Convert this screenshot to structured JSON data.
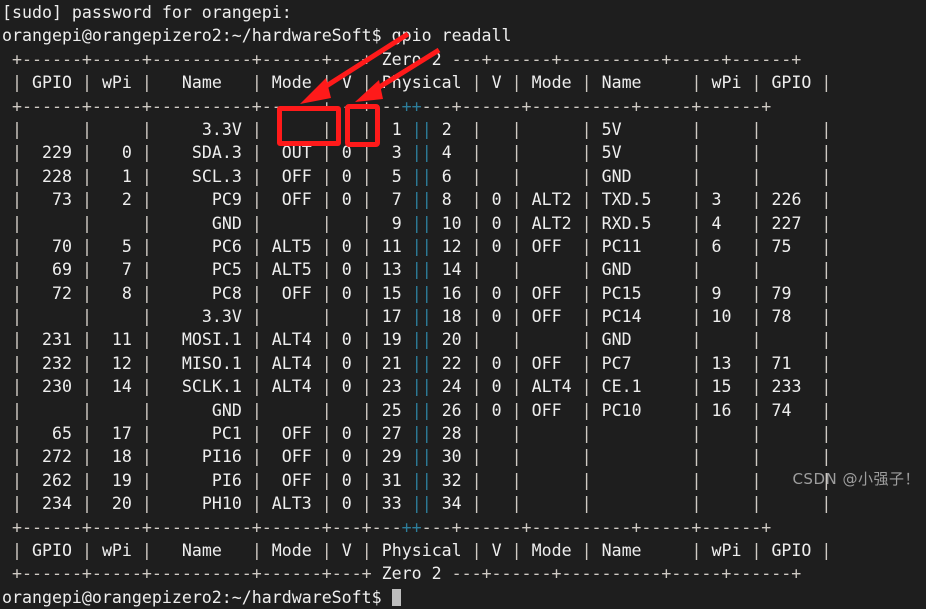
{
  "terminal": {
    "prompt_user_host": "orangepi@orangepizero2:~/hardwareSoft$",
    "sudo_line": "[sudo] password for orangepi:",
    "command": "gpio readall",
    "board_label": "Zero 2",
    "final_prompt": "orangepi@orangepizero2:~/hardwareSoft$"
  },
  "table": {
    "headers": [
      "GPIO",
      "wPi",
      "Name",
      "Mode",
      "V",
      "Physical",
      "V",
      "Mode",
      "Name",
      "wPi",
      "GPIO"
    ],
    "separator_top": "+------+-----+----------+------+---+",
    "separator_mid": "+------+-----+----------+------+---+---++---+---+------+----------+-----+------+",
    "rows": [
      {
        "gpio_l": "",
        "wpi_l": "",
        "name_l": "3.3V",
        "mode_l": "",
        "v_l": "",
        "phys_l": "1",
        "phys_r": "2",
        "v_r": "",
        "mode_r": "",
        "name_r": "5V",
        "wpi_r": "",
        "gpio_r": ""
      },
      {
        "gpio_l": "229",
        "wpi_l": "0",
        "name_l": "SDA.3",
        "mode_l": "OUT",
        "v_l": "0",
        "phys_l": "3",
        "phys_r": "4",
        "v_r": "",
        "mode_r": "",
        "name_r": "5V",
        "wpi_r": "",
        "gpio_r": ""
      },
      {
        "gpio_l": "228",
        "wpi_l": "1",
        "name_l": "SCL.3",
        "mode_l": "OFF",
        "v_l": "0",
        "phys_l": "5",
        "phys_r": "6",
        "v_r": "",
        "mode_r": "",
        "name_r": "GND",
        "wpi_r": "",
        "gpio_r": ""
      },
      {
        "gpio_l": "73",
        "wpi_l": "2",
        "name_l": "PC9",
        "mode_l": "OFF",
        "v_l": "0",
        "phys_l": "7",
        "phys_r": "8",
        "v_r": "0",
        "mode_r": "ALT2",
        "name_r": "TXD.5",
        "wpi_r": "3",
        "gpio_r": "226"
      },
      {
        "gpio_l": "",
        "wpi_l": "",
        "name_l": "GND",
        "mode_l": "",
        "v_l": "",
        "phys_l": "9",
        "phys_r": "10",
        "v_r": "0",
        "mode_r": "ALT2",
        "name_r": "RXD.5",
        "wpi_r": "4",
        "gpio_r": "227"
      },
      {
        "gpio_l": "70",
        "wpi_l": "5",
        "name_l": "PC6",
        "mode_l": "ALT5",
        "v_l": "0",
        "phys_l": "11",
        "phys_r": "12",
        "v_r": "0",
        "mode_r": "OFF",
        "name_r": "PC11",
        "wpi_r": "6",
        "gpio_r": "75"
      },
      {
        "gpio_l": "69",
        "wpi_l": "7",
        "name_l": "PC5",
        "mode_l": "ALT5",
        "v_l": "0",
        "phys_l": "13",
        "phys_r": "14",
        "v_r": "",
        "mode_r": "",
        "name_r": "GND",
        "wpi_r": "",
        "gpio_r": ""
      },
      {
        "gpio_l": "72",
        "wpi_l": "8",
        "name_l": "PC8",
        "mode_l": "OFF",
        "v_l": "0",
        "phys_l": "15",
        "phys_r": "16",
        "v_r": "0",
        "mode_r": "OFF",
        "name_r": "PC15",
        "wpi_r": "9",
        "gpio_r": "79"
      },
      {
        "gpio_l": "",
        "wpi_l": "",
        "name_l": "3.3V",
        "mode_l": "",
        "v_l": "",
        "phys_l": "17",
        "phys_r": "18",
        "v_r": "0",
        "mode_r": "OFF",
        "name_r": "PC14",
        "wpi_r": "10",
        "gpio_r": "78"
      },
      {
        "gpio_l": "231",
        "wpi_l": "11",
        "name_l": "MOSI.1",
        "mode_l": "ALT4",
        "v_l": "0",
        "phys_l": "19",
        "phys_r": "20",
        "v_r": "",
        "mode_r": "",
        "name_r": "GND",
        "wpi_r": "",
        "gpio_r": ""
      },
      {
        "gpio_l": "232",
        "wpi_l": "12",
        "name_l": "MISO.1",
        "mode_l": "ALT4",
        "v_l": "0",
        "phys_l": "21",
        "phys_r": "22",
        "v_r": "0",
        "mode_r": "OFF",
        "name_r": "PC7",
        "wpi_r": "13",
        "gpio_r": "71"
      },
      {
        "gpio_l": "230",
        "wpi_l": "14",
        "name_l": "SCLK.1",
        "mode_l": "ALT4",
        "v_l": "0",
        "phys_l": "23",
        "phys_r": "24",
        "v_r": "0",
        "mode_r": "ALT4",
        "name_r": "CE.1",
        "wpi_r": "15",
        "gpio_r": "233"
      },
      {
        "gpio_l": "",
        "wpi_l": "",
        "name_l": "GND",
        "mode_l": "",
        "v_l": "",
        "phys_l": "25",
        "phys_r": "26",
        "v_r": "0",
        "mode_r": "OFF",
        "name_r": "PC10",
        "wpi_r": "16",
        "gpio_r": "74"
      },
      {
        "gpio_l": "65",
        "wpi_l": "17",
        "name_l": "PC1",
        "mode_l": "OFF",
        "v_l": "0",
        "phys_l": "27",
        "phys_r": "28",
        "v_r": "",
        "mode_r": "",
        "name_r": "",
        "wpi_r": "",
        "gpio_r": ""
      },
      {
        "gpio_l": "272",
        "wpi_l": "18",
        "name_l": "PI16",
        "mode_l": "OFF",
        "v_l": "0",
        "phys_l": "29",
        "phys_r": "30",
        "v_r": "",
        "mode_r": "",
        "name_r": "",
        "wpi_r": "",
        "gpio_r": ""
      },
      {
        "gpio_l": "262",
        "wpi_l": "19",
        "name_l": "PI6",
        "mode_l": "OFF",
        "v_l": "0",
        "phys_l": "31",
        "phys_r": "32",
        "v_r": "",
        "mode_r": "",
        "name_r": "",
        "wpi_r": "",
        "gpio_r": ""
      },
      {
        "gpio_l": "234",
        "wpi_l": "20",
        "name_l": "PH10",
        "mode_l": "ALT3",
        "v_l": "0",
        "phys_l": "33",
        "phys_r": "34",
        "v_r": "",
        "mode_r": "",
        "name_r": "",
        "wpi_r": "",
        "gpio_r": ""
      }
    ]
  },
  "annotations": {
    "highlight_mode_value": "OUT",
    "highlight_v_value": "0",
    "color": "#ff1a1a"
  },
  "watermark": {
    "text": "CSDN @小强子！"
  },
  "colors": {
    "background": "#1e1e1e",
    "text": "#eeeeee",
    "border": "#cfcac4",
    "center_separator": "#2d7d9a",
    "annotation": "#ff1a1a"
  }
}
